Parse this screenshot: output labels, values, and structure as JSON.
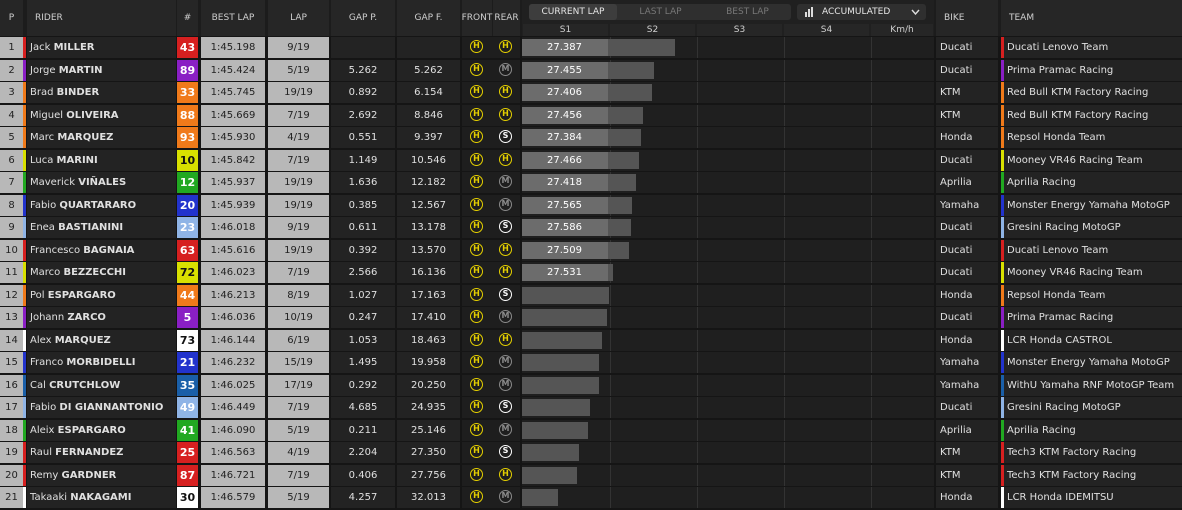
{
  "headers": {
    "pos": "P",
    "rider": "RIDER",
    "num": "#",
    "best_lap": "BEST LAP",
    "lap": "LAP",
    "gap_p": "GAP P.",
    "gap_f": "GAP F.",
    "front": "FRONT",
    "rear": "REAR",
    "bike": "BIKE",
    "team": "TEAM"
  },
  "tabs": [
    "CURRENT LAP",
    "LAST LAP",
    "BEST LAP"
  ],
  "active_tab": "CURRENT LAP",
  "dropdown": {
    "label": "ACCUMULATED",
    "icon": "bar-chart-icon",
    "chevron": "chevron-down-icon"
  },
  "sectors": [
    "S1",
    "S2",
    "S3",
    "S4",
    "Km/h"
  ],
  "colors": {
    "header_bg": "#262626",
    "row_dark": "#232323",
    "row_light": "#b8b8b8",
    "tyre_hard": "#e5d000",
    "tyre_medium": "#8a8a8a",
    "tyre_soft": "#ffffff"
  },
  "riders": [
    {
      "pos": "1",
      "first": "Jack",
      "last": "MILLER",
      "num": "43",
      "num_bg": "#d62020",
      "num_fg": "#ffffff",
      "best": "1:45.198",
      "lap": "9/19",
      "gap_p": "",
      "gap_f": "",
      "front": "H",
      "rear": "H",
      "s1": "27.387",
      "progress": 0.86,
      "bike": "Ducati",
      "team": "Ducati Lenovo Team",
      "team_color": "#d62020"
    },
    {
      "pos": "2",
      "first": "Jorge",
      "last": "MARTIN",
      "num": "89",
      "num_bg": "#8a1fc4",
      "num_fg": "#ffffff",
      "best": "1:45.424",
      "lap": "5/19",
      "gap_p": "5.262",
      "gap_f": "5.262",
      "front": "H",
      "rear": "M",
      "s1": "27.455",
      "progress": 0.74,
      "bike": "Ducati",
      "team": "Prima Pramac Racing",
      "team_color": "#8a1fc4"
    },
    {
      "pos": "3",
      "first": "Brad",
      "last": "BINDER",
      "num": "33",
      "num_bg": "#f07a1a",
      "num_fg": "#ffffff",
      "best": "1:45.745",
      "lap": "19/19",
      "gap_p": "0.892",
      "gap_f": "6.154",
      "front": "H",
      "rear": "H",
      "s1": "27.406",
      "progress": 0.73,
      "bike": "KTM",
      "team": "Red Bull KTM Factory Racing",
      "team_color": "#f07a1a"
    },
    {
      "pos": "4",
      "first": "Miguel",
      "last": "OLIVEIRA",
      "num": "88",
      "num_bg": "#f07a1a",
      "num_fg": "#ffffff",
      "best": "1:45.669",
      "lap": "7/19",
      "gap_p": "2.692",
      "gap_f": "8.846",
      "front": "H",
      "rear": "H",
      "s1": "27.456",
      "progress": 0.68,
      "bike": "KTM",
      "team": "Red Bull KTM Factory Racing",
      "team_color": "#f07a1a"
    },
    {
      "pos": "5",
      "first": "Marc",
      "last": "MARQUEZ",
      "num": "93",
      "num_bg": "#f07a1a",
      "num_fg": "#ffffff",
      "best": "1:45.930",
      "lap": "4/19",
      "gap_p": "0.551",
      "gap_f": "9.397",
      "front": "H",
      "rear": "S",
      "s1": "27.384",
      "progress": 0.67,
      "bike": "Honda",
      "team": "Repsol Honda Team",
      "team_color": "#f07a1a"
    },
    {
      "pos": "6",
      "first": "Luca",
      "last": "MARINI",
      "num": "10",
      "num_bg": "#d8e000",
      "num_fg": "#111111",
      "best": "1:45.842",
      "lap": "7/19",
      "gap_p": "1.149",
      "gap_f": "10.546",
      "front": "H",
      "rear": "H",
      "s1": "27.466",
      "progress": 0.66,
      "bike": "Ducati",
      "team": "Mooney VR46 Racing Team",
      "team_color": "#d8e000"
    },
    {
      "pos": "7",
      "first": "Maverick",
      "last": "VIÑALES",
      "num": "12",
      "num_bg": "#21a821",
      "num_fg": "#ffffff",
      "best": "1:45.937",
      "lap": "19/19",
      "gap_p": "1.636",
      "gap_f": "12.182",
      "front": "H",
      "rear": "M",
      "s1": "27.418",
      "progress": 0.64,
      "bike": "Aprilia",
      "team": "Aprilia Racing",
      "team_color": "#21a821"
    },
    {
      "pos": "8",
      "first": "Fabio",
      "last": "QUARTARARO",
      "num": "20",
      "num_bg": "#2233cc",
      "num_fg": "#ffffff",
      "best": "1:45.939",
      "lap": "19/19",
      "gap_p": "0.385",
      "gap_f": "12.567",
      "front": "H",
      "rear": "M",
      "s1": "27.565",
      "progress": 0.62,
      "bike": "Yamaha",
      "team": "Monster Energy Yamaha MotoGP",
      "team_color": "#2233cc"
    },
    {
      "pos": "9",
      "first": "Enea",
      "last": "BASTIANINI",
      "num": "23",
      "num_bg": "#8fb4e6",
      "num_fg": "#ffffff",
      "best": "1:46.018",
      "lap": "9/19",
      "gap_p": "0.611",
      "gap_f": "13.178",
      "front": "H",
      "rear": "S",
      "s1": "27.586",
      "progress": 0.61,
      "bike": "Ducati",
      "team": "Gresini Racing MotoGP",
      "team_color": "#8fb4e6"
    },
    {
      "pos": "10",
      "first": "Francesco",
      "last": "BAGNAIA",
      "num": "63",
      "num_bg": "#d62020",
      "num_fg": "#ffffff",
      "best": "1:45.616",
      "lap": "19/19",
      "gap_p": "0.392",
      "gap_f": "13.570",
      "front": "H",
      "rear": "H",
      "s1": "27.509",
      "progress": 0.6,
      "bike": "Ducati",
      "team": "Ducati Lenovo Team",
      "team_color": "#d62020"
    },
    {
      "pos": "11",
      "first": "Marco",
      "last": "BEZZECCHI",
      "num": "72",
      "num_bg": "#d8e000",
      "num_fg": "#111111",
      "best": "1:46.023",
      "lap": "7/19",
      "gap_p": "2.566",
      "gap_f": "16.136",
      "front": "H",
      "rear": "H",
      "s1": "27.531",
      "progress": 0.51,
      "bike": "Ducati",
      "team": "Mooney VR46 Racing Team",
      "team_color": "#d8e000"
    },
    {
      "pos": "12",
      "first": "Pol",
      "last": "ESPARGARO",
      "num": "44",
      "num_bg": "#f07a1a",
      "num_fg": "#ffffff",
      "best": "1:46.213",
      "lap": "8/19",
      "gap_p": "1.027",
      "gap_f": "17.163",
      "front": "H",
      "rear": "S",
      "s1": "",
      "progress": 0.49,
      "bike": "Honda",
      "team": "Repsol Honda Team",
      "team_color": "#f07a1a"
    },
    {
      "pos": "13",
      "first": "Johann",
      "last": "ZARCO",
      "num": "5",
      "num_bg": "#8a1fc4",
      "num_fg": "#ffffff",
      "best": "1:46.036",
      "lap": "10/19",
      "gap_p": "0.247",
      "gap_f": "17.410",
      "front": "H",
      "rear": "M",
      "s1": "",
      "progress": 0.48,
      "bike": "Ducati",
      "team": "Prima Pramac Racing",
      "team_color": "#8a1fc4"
    },
    {
      "pos": "14",
      "first": "Alex",
      "last": "MARQUEZ",
      "num": "73",
      "num_bg": "#ffffff",
      "num_fg": "#111111",
      "best": "1:46.144",
      "lap": "6/19",
      "gap_p": "1.053",
      "gap_f": "18.463",
      "front": "H",
      "rear": "H",
      "s1": "",
      "progress": 0.45,
      "bike": "Honda",
      "team": "LCR Honda CASTROL",
      "team_color": "#ffffff"
    },
    {
      "pos": "15",
      "first": "Franco",
      "last": "MORBIDELLI",
      "num": "21",
      "num_bg": "#2233cc",
      "num_fg": "#ffffff",
      "best": "1:46.232",
      "lap": "15/19",
      "gap_p": "1.495",
      "gap_f": "19.958",
      "front": "H",
      "rear": "M",
      "s1": "",
      "progress": 0.43,
      "bike": "Yamaha",
      "team": "Monster Energy Yamaha MotoGP",
      "team_color": "#2233cc"
    },
    {
      "pos": "16",
      "first": "Cal",
      "last": "CRUTCHLOW",
      "num": "35",
      "num_bg": "#1a5fa8",
      "num_fg": "#ffffff",
      "best": "1:46.025",
      "lap": "17/19",
      "gap_p": "0.292",
      "gap_f": "20.250",
      "front": "H",
      "rear": "M",
      "s1": "",
      "progress": 0.43,
      "bike": "Yamaha",
      "team": "WithU Yamaha RNF MotoGP Team",
      "team_color": "#1a5fa8"
    },
    {
      "pos": "17",
      "first": "Fabio",
      "last": "DI GIANNANTONIO",
      "num": "49",
      "num_bg": "#8fb4e6",
      "num_fg": "#ffffff",
      "best": "1:46.449",
      "lap": "7/19",
      "gap_p": "4.685",
      "gap_f": "24.935",
      "front": "H",
      "rear": "S",
      "s1": "",
      "progress": 0.38,
      "bike": "Ducati",
      "team": "Gresini Racing MotoGP",
      "team_color": "#8fb4e6"
    },
    {
      "pos": "18",
      "first": "Aleix",
      "last": "ESPARGARO",
      "num": "41",
      "num_bg": "#21a821",
      "num_fg": "#ffffff",
      "best": "1:46.090",
      "lap": "5/19",
      "gap_p": "0.211",
      "gap_f": "25.146",
      "front": "H",
      "rear": "M",
      "s1": "",
      "progress": 0.37,
      "bike": "Aprilia",
      "team": "Aprilia Racing",
      "team_color": "#21a821"
    },
    {
      "pos": "19",
      "first": "Raul",
      "last": "FERNANDEZ",
      "num": "25",
      "num_bg": "#d62020",
      "num_fg": "#ffffff",
      "best": "1:46.563",
      "lap": "4/19",
      "gap_p": "2.204",
      "gap_f": "27.350",
      "front": "H",
      "rear": "S",
      "s1": "",
      "progress": 0.32,
      "bike": "KTM",
      "team": "Tech3 KTM Factory Racing",
      "team_color": "#d62020"
    },
    {
      "pos": "20",
      "first": "Remy",
      "last": "GARDNER",
      "num": "87",
      "num_bg": "#d62020",
      "num_fg": "#ffffff",
      "best": "1:46.721",
      "lap": "7/19",
      "gap_p": "0.406",
      "gap_f": "27.756",
      "front": "H",
      "rear": "H",
      "s1": "",
      "progress": 0.31,
      "bike": "KTM",
      "team": "Tech3 KTM Factory Racing",
      "team_color": "#d62020"
    },
    {
      "pos": "21",
      "first": "Takaaki",
      "last": "NAKAGAMI",
      "num": "30",
      "num_bg": "#ffffff",
      "num_fg": "#111111",
      "best": "1:46.579",
      "lap": "5/19",
      "gap_p": "4.257",
      "gap_f": "32.013",
      "front": "H",
      "rear": "M",
      "s1": "",
      "progress": 0.2,
      "bike": "Honda",
      "team": "LCR Honda IDEMITSU",
      "team_color": "#ffffff"
    }
  ]
}
